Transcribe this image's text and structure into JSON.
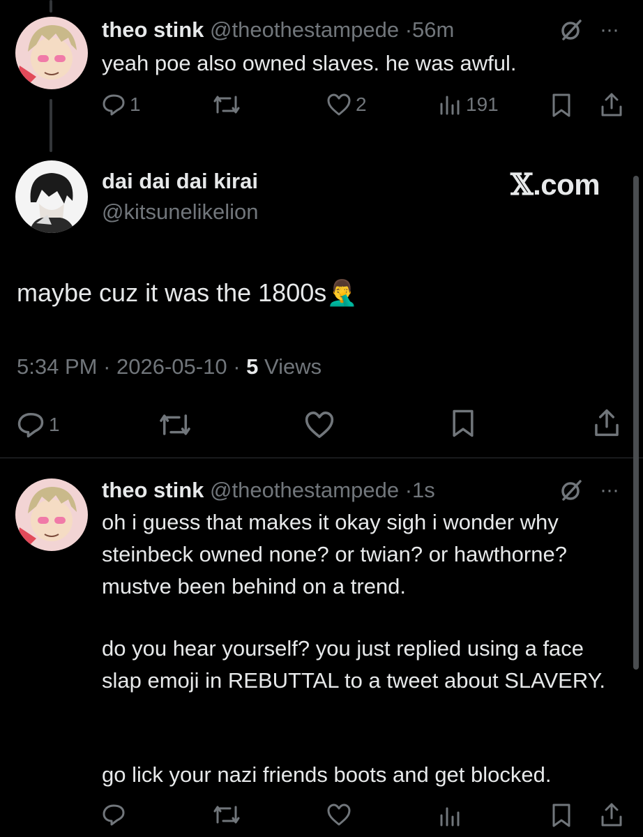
{
  "reply1": {
    "name": "theo stink",
    "handle": "@theothestampede",
    "time": "56m",
    "text": "yeah poe also owned slaves. he was awful.",
    "replies": "1",
    "likes": "2",
    "views": "191"
  },
  "main": {
    "name": "dai dai dai kirai",
    "handle": "@kitsunelikelion",
    "watermark_x": "𝕏",
    "watermark_rest": ".com",
    "text": "maybe cuz it was the 1800s",
    "emoji": "🤦‍♂️",
    "time": "5:34 PM",
    "date": "2026-05-10",
    "views_count": "5",
    "views_label": "Views",
    "replies": "1"
  },
  "reply2": {
    "name": "theo stink",
    "handle": "@theothestampede",
    "time": "1s",
    "paragraph1": "oh i guess that makes it okay sigh i wonder why steinbeck owned none? or twian? or hawthorne? mustve been behind on a trend.",
    "paragraph2": "do you hear yourself? you just replied using a face slap emoji in REBUTTAL to a tweet about SLAVERY.",
    "paragraph3": "go lick your nazi friends boots and get blocked."
  },
  "icons": {
    "reply": "reply-icon",
    "repost": "repost-icon",
    "like": "heart-icon",
    "views": "views-icon",
    "bookmark": "bookmark-icon",
    "share": "share-icon",
    "grok": "grok-icon",
    "more": "more-icon"
  },
  "colors": {
    "background": "#000000",
    "text": "#e7e9ea",
    "muted": "#71767b",
    "divider": "#2f3336"
  }
}
